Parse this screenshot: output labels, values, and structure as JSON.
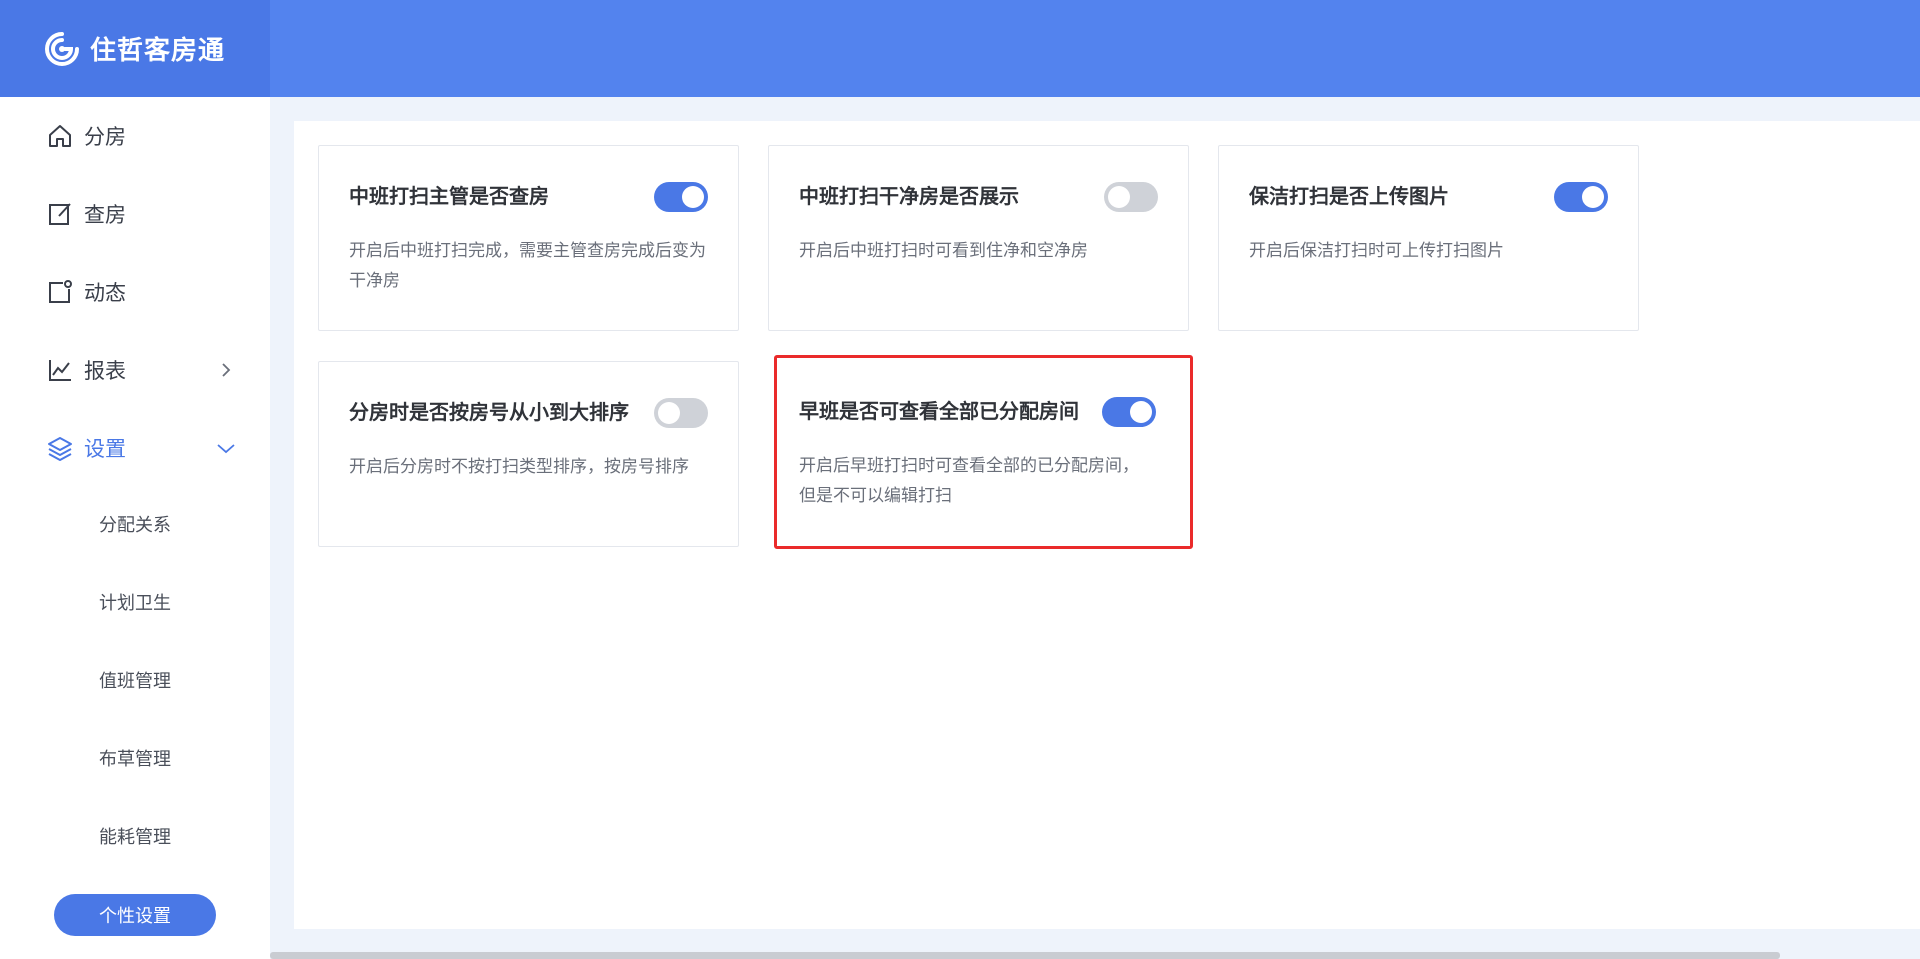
{
  "brand": {
    "name": "住哲客房通"
  },
  "sidebar": {
    "items": [
      {
        "label": "分房"
      },
      {
        "label": "查房"
      },
      {
        "label": "动态"
      },
      {
        "label": "报表"
      },
      {
        "label": "设置"
      }
    ],
    "settings_children": [
      {
        "label": "分配关系"
      },
      {
        "label": "计划卫生"
      },
      {
        "label": "值班管理"
      },
      {
        "label": "布草管理"
      },
      {
        "label": "能耗管理"
      },
      {
        "label": "个性设置"
      }
    ]
  },
  "cards": [
    {
      "title": "中班打扫主管是否查房",
      "desc": "开启后中班打扫完成，需要主管查房完成后变为干净房",
      "enabled": true
    },
    {
      "title": "中班打扫干净房是否展示",
      "desc": "开启后中班打扫时可看到住净和空净房",
      "enabled": false
    },
    {
      "title": "保洁打扫是否上传图片",
      "desc": "开启后保洁打扫时可上传打扫图片",
      "enabled": true
    },
    {
      "title": "分房时是否按房号从小到大排序",
      "desc": "开启后分房时不按打扫类型排序，按房号排序",
      "enabled": false
    },
    {
      "title": "早班是否可查看全部已分配房间",
      "desc": "开启后早班打扫时可查看全部的已分配房间，但是不可以编辑打扫",
      "enabled": true
    }
  ],
  "colors": {
    "header": "#5383ee",
    "accent": "#4a78e6",
    "highlight_border": "#ea2a2a",
    "toggle_off": "#cfd2d8"
  }
}
